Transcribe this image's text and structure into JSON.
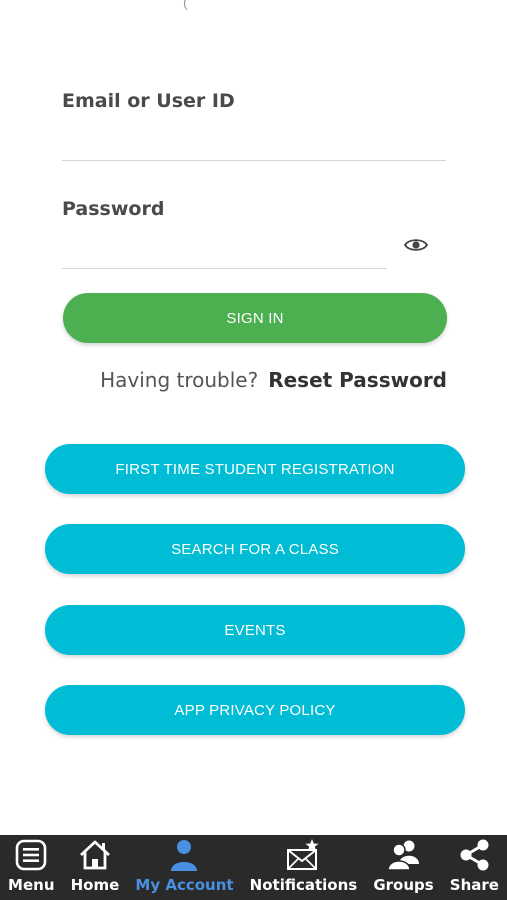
{
  "top_fragment": "(",
  "form": {
    "email_label": "Email or User ID",
    "email_value": "",
    "password_label": "Password",
    "password_value": ""
  },
  "sign_in_label": "SIGN IN",
  "help": {
    "trouble_text": "Having trouble?",
    "reset_label": "Reset Password"
  },
  "actions": [
    {
      "label": "FIRST TIME STUDENT REGISTRATION"
    },
    {
      "label": "SEARCH FOR A CLASS"
    },
    {
      "label": "EVENTS"
    },
    {
      "label": "APP PRIVACY POLICY"
    }
  ],
  "colors": {
    "sign_in": "#4caf50",
    "action": "#00bcd4",
    "tabbar_bg": "#2a2a2a",
    "tab_active": "#4a90e2"
  },
  "tabs": [
    {
      "label": "Menu",
      "icon": "menu-icon",
      "active": false
    },
    {
      "label": "Home",
      "icon": "home-icon",
      "active": false
    },
    {
      "label": "My Account",
      "icon": "user-icon",
      "active": true
    },
    {
      "label": "Notifications",
      "icon": "envelope-star-icon",
      "active": false
    },
    {
      "label": "Groups",
      "icon": "groups-icon",
      "active": false
    },
    {
      "label": "Share",
      "icon": "share-icon",
      "active": false
    }
  ]
}
